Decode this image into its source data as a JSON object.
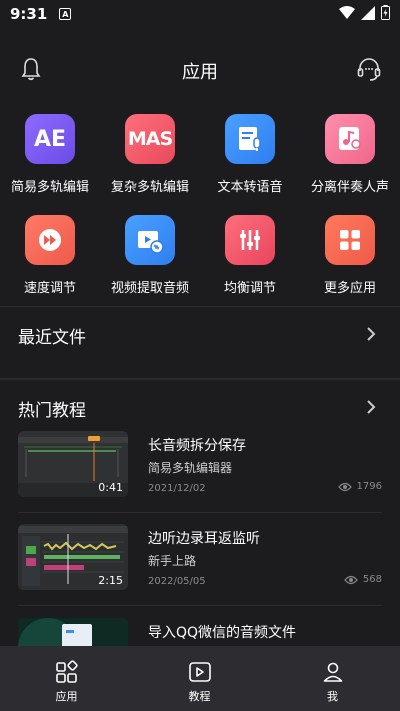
{
  "status": {
    "time": "9:31",
    "indicator": "A"
  },
  "header": {
    "title": "应用",
    "left_icon": "bell-icon",
    "right_icon": "headset-icon"
  },
  "apps": [
    {
      "label": "简易多轨编辑",
      "icon_text": "AE",
      "color": "#7b5cf0"
    },
    {
      "label": "复杂多轨编辑",
      "icon_text": "MAS",
      "color": "#f05a6a"
    },
    {
      "label": "文本转语音",
      "icon": "document-mic-icon",
      "color": "#3a8ef5"
    },
    {
      "label": "分离伴奏人声",
      "icon": "music-mic-icon",
      "color": "#f47a9a"
    },
    {
      "label": "速度调节",
      "icon": "fast-forward-icon",
      "color": "#f56a5a"
    },
    {
      "label": "视频提取音频",
      "icon": "video-audio-icon",
      "color": "#3a8ef5"
    },
    {
      "label": "均衡调节",
      "icon": "equalizer-icon",
      "color": "#f0506a"
    },
    {
      "label": "更多应用",
      "icon": "grid-icon",
      "color": "#f06050"
    }
  ],
  "recent": {
    "title": "最近文件"
  },
  "tutorials": {
    "title": "热门教程",
    "items": [
      {
        "title": "长音频拆分保存",
        "subtitle": "简易多轨编辑器",
        "date": "2021/12/02",
        "views": "1796",
        "duration": "0:41"
      },
      {
        "title": "边听边录耳返监听",
        "subtitle": "新手上路",
        "date": "2022/05/05",
        "views": "568",
        "duration": "2:15"
      },
      {
        "title": "导入QQ微信的音频文件"
      }
    ]
  },
  "nav": [
    {
      "label": "应用",
      "icon": "apps-icon"
    },
    {
      "label": "教程",
      "icon": "tutorial-icon"
    },
    {
      "label": "我",
      "icon": "profile-icon"
    }
  ]
}
